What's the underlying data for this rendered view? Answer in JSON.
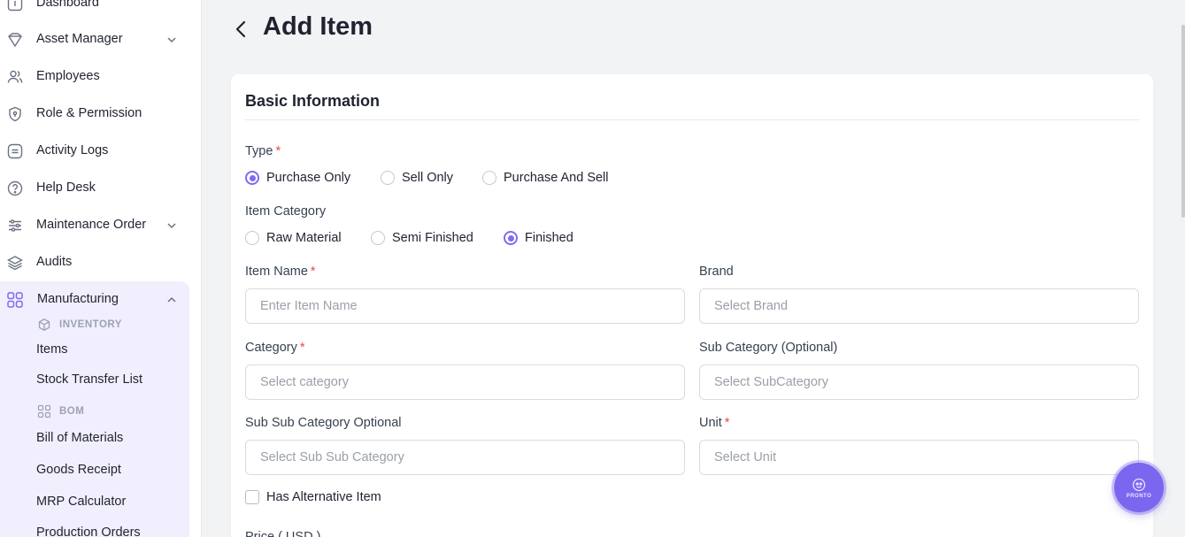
{
  "sidebar": {
    "items": [
      {
        "label": "Dashboard",
        "icon": "dashboard-icon"
      },
      {
        "label": "Asset Manager",
        "icon": "asset-icon",
        "expandable": true
      },
      {
        "label": "Employees",
        "icon": "users-icon"
      },
      {
        "label": "Role & Permission",
        "icon": "shield-icon"
      },
      {
        "label": "Activity Logs",
        "icon": "logs-icon"
      },
      {
        "label": "Help Desk",
        "icon": "help-icon"
      },
      {
        "label": "Maintenance Order",
        "icon": "sliders-icon",
        "expandable": true
      },
      {
        "label": "Audits",
        "icon": "layers-icon"
      }
    ],
    "manufacturing": {
      "label": "Manufacturing",
      "icon": "grid-icon",
      "expanded": true,
      "inventory_heading": "INVENTORY",
      "inventory_items": [
        "Items",
        "Stock Transfer List"
      ],
      "bom_heading": "BOM",
      "bom_items": [
        "Bill of Materials",
        "Goods Receipt",
        "MRP Calculator",
        "Production Orders"
      ]
    }
  },
  "page": {
    "title": "Add Item",
    "back_icon": "chevron-left-icon"
  },
  "form": {
    "section_title": "Basic Information",
    "type": {
      "label": "Type",
      "options": [
        "Purchase Only",
        "Sell Only",
        "Purchase And Sell"
      ],
      "selected": "Purchase Only"
    },
    "item_category": {
      "label": "Item Category",
      "options": [
        "Raw Material",
        "Semi Finished",
        "Finished"
      ],
      "selected": "Finished"
    },
    "item_name": {
      "label": "Item Name",
      "placeholder": "Enter Item Name",
      "value": ""
    },
    "brand": {
      "label": "Brand",
      "placeholder": "Select Brand",
      "value": ""
    },
    "category": {
      "label": "Category",
      "placeholder": "Select category",
      "value": ""
    },
    "sub_category": {
      "label": "Sub Category (Optional)",
      "placeholder": "Select SubCategory",
      "value": ""
    },
    "sub_sub_category": {
      "label": "Sub Sub Category Optional",
      "placeholder": "Select Sub Sub Category",
      "value": ""
    },
    "unit": {
      "label": "Unit",
      "placeholder": "Select Unit",
      "value": ""
    },
    "has_alternative": {
      "label": "Has Alternative Item",
      "checked": false
    },
    "price_label": "Price ( USD )",
    "required_mark": "*"
  },
  "fab": {
    "text": "PRONTO",
    "icon": "assistant-icon"
  },
  "colors": {
    "accent": "#7c6cf2",
    "required": "#e5484d",
    "manufacturing_bg": "#f1effd"
  }
}
